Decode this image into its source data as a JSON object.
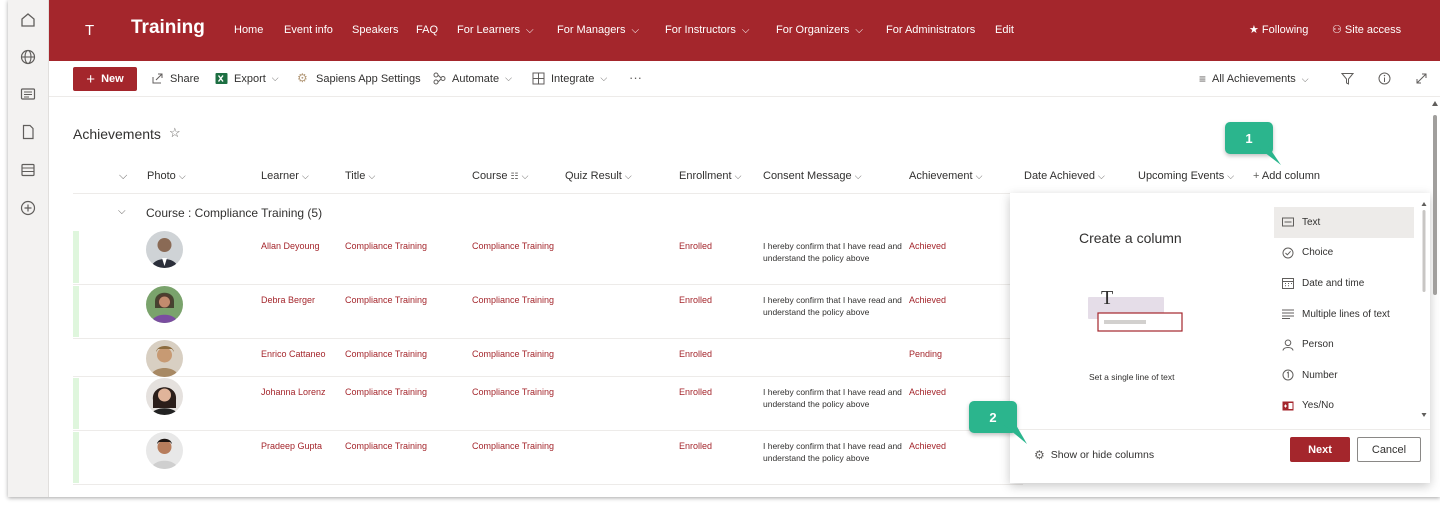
{
  "site": {
    "logo_letter": "T",
    "title": "Training"
  },
  "topnav": [
    "Home",
    "Event info",
    "Speakers",
    "FAQ",
    "For Learners",
    "For Managers",
    "For Instructors",
    "For Organizers",
    "For Administrators",
    "Edit"
  ],
  "header_right": {
    "following": "Following",
    "site_access": "Site access"
  },
  "commands": {
    "new": "New",
    "share": "Share",
    "export": "Export",
    "sapiens": "Sapiens App Settings",
    "automate": "Automate",
    "integrate": "Integrate",
    "more": "···",
    "view": "All Achievements"
  },
  "list": {
    "title": "Achievements",
    "columns": [
      "Photo",
      "Learner",
      "Title",
      "Course",
      "Quiz Result",
      "Enrollment",
      "Consent Message",
      "Achievement",
      "Date Achieved",
      "Upcoming Events",
      "Add column"
    ],
    "group_label": "Course : Compliance Training  (5)",
    "rows": [
      {
        "learner": "Allan Deyoung",
        "title": "Compliance Training",
        "course": "Compliance Training",
        "enrollment": "Enrolled",
        "consent": "I hereby confirm that I have read and understand the policy above",
        "achievement": "Achieved"
      },
      {
        "learner": "Debra Berger",
        "title": "Compliance Training",
        "course": "Compliance Training",
        "enrollment": "Enrolled",
        "consent": "I hereby confirm that I have read and understand the policy above",
        "achievement": "Achieved"
      },
      {
        "learner": "Enrico Cattaneo",
        "title": "Compliance Training",
        "course": "Compliance Training",
        "enrollment": "Enrolled",
        "consent": "",
        "achievement": "Pending"
      },
      {
        "learner": "Johanna Lorenz",
        "title": "Compliance Training",
        "course": "Compliance Training",
        "enrollment": "Enrolled",
        "consent": "I hereby confirm that I have read and understand the policy above",
        "achievement": "Achieved"
      },
      {
        "learner": "Pradeep Gupta",
        "title": "Compliance Training",
        "course": "Compliance Training",
        "enrollment": "Enrolled",
        "consent": "I hereby confirm that I have read and understand the policy above",
        "achievement": "Achieved"
      }
    ]
  },
  "callouts": {
    "one": "1",
    "two": "2"
  },
  "panel": {
    "title": "Create a column",
    "description": "Set a single line of text",
    "types": [
      "Text",
      "Choice",
      "Date and time",
      "Multiple lines of text",
      "Person",
      "Number",
      "Yes/No"
    ],
    "selected_type": "Text",
    "show_hide": "Show or hide columns",
    "next": "Next",
    "cancel": "Cancel"
  },
  "colors": {
    "brand": "#a4262c",
    "callout": "#2bb58d",
    "success_bar": "#dff6dd"
  }
}
